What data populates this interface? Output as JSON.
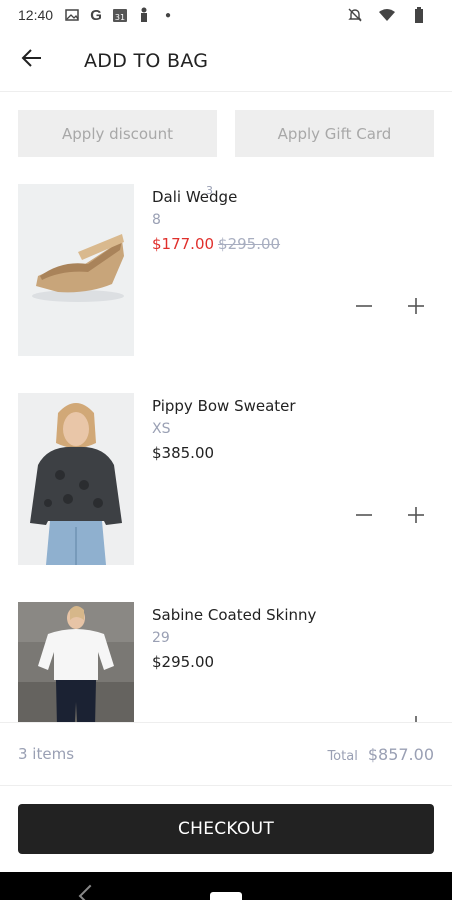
{
  "status_bar": {
    "time": "12:40",
    "left_icons": [
      "image-icon",
      "google-icon",
      "calendar-icon",
      "figure-icon",
      "dot-icon"
    ],
    "calendar_day": "31",
    "right_icons": [
      "notifications-off-icon",
      "wifi-icon",
      "battery-icon"
    ]
  },
  "header": {
    "title": "ADD TO BAG",
    "back_icon": "arrow-left-icon"
  },
  "actions": {
    "discount_label": "Apply discount",
    "gift_card_label": "Apply Gift Card"
  },
  "products": [
    {
      "name": "Dali Wedge",
      "variant": "8",
      "price": "$177.00",
      "original_price": "$295.00",
      "on_sale": true,
      "overlay_digit": "3"
    },
    {
      "name": "Pippy Bow Sweater",
      "variant": "XS",
      "price": "$385.00",
      "on_sale": false
    },
    {
      "name": "Sabine Coated Skinny",
      "variant": "29",
      "price": "$295.00",
      "on_sale": false
    }
  ],
  "summary": {
    "items_count": "3 items",
    "total_label": "Total",
    "total_value": "$857.00"
  },
  "checkout": {
    "label": "CHECKOUT"
  },
  "colors": {
    "sale_red": "#e0302c",
    "muted": "#9aa0b4",
    "button_bg": "#eeeeee",
    "checkout_bg": "#222222"
  }
}
